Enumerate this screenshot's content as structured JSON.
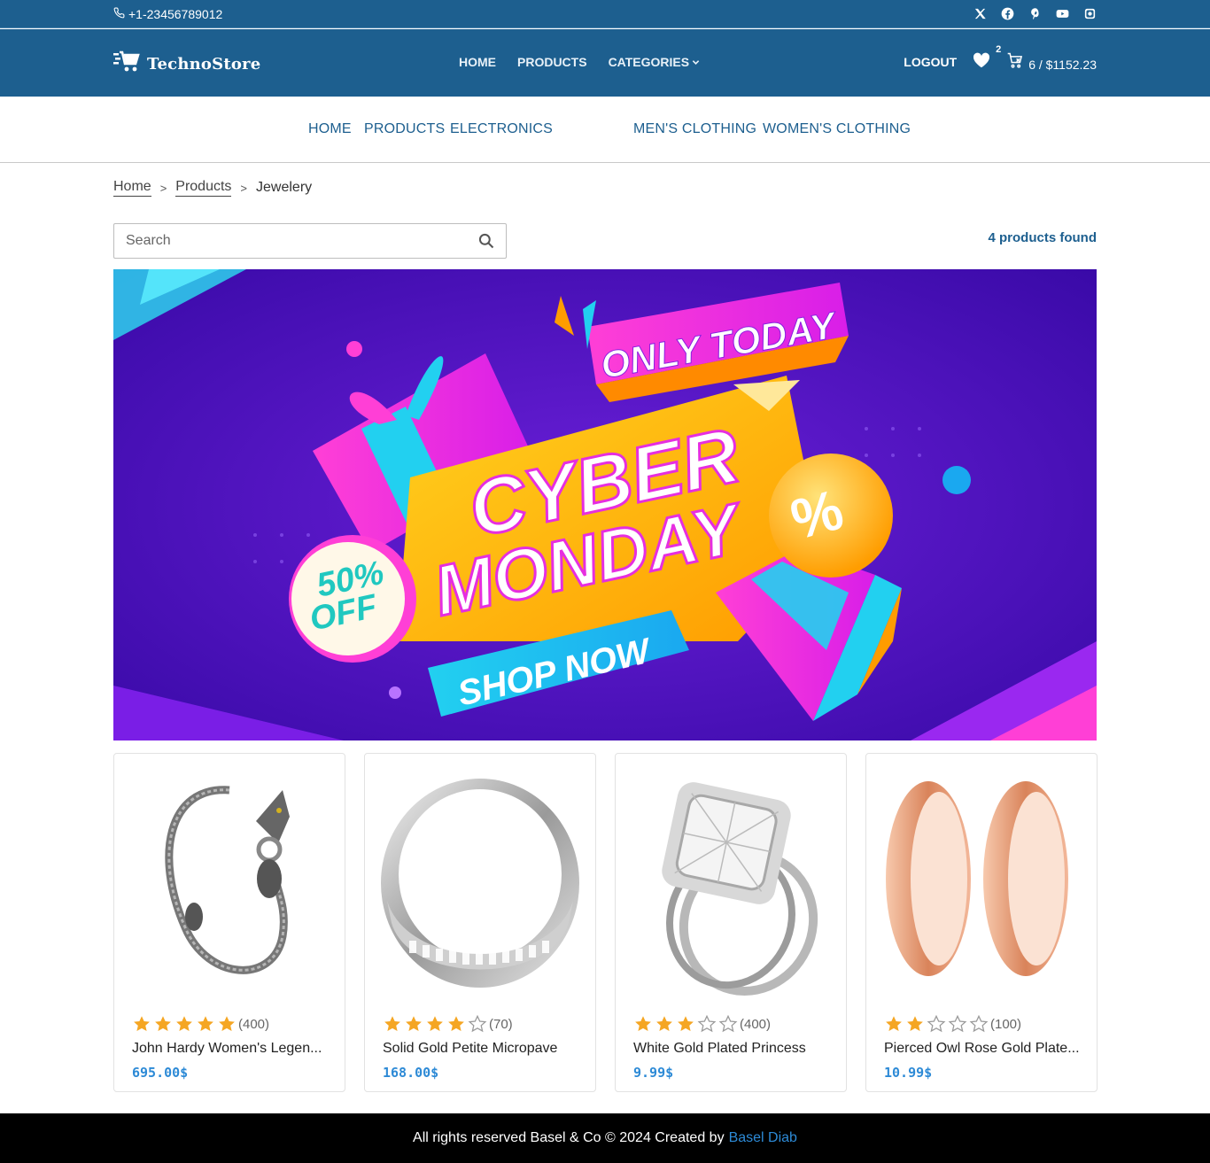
{
  "topbar": {
    "phone": "+1-23456789012",
    "socials": [
      "x-icon",
      "facebook-icon",
      "pinterest-icon",
      "youtube-icon",
      "instagram-icon"
    ]
  },
  "header": {
    "brand": "TechnoStore",
    "nav": [
      {
        "label": "HOME"
      },
      {
        "label": "PRODUCTS"
      },
      {
        "label": "CATEGORIES"
      }
    ],
    "logout": "LOGOUT",
    "wishlist_count": "2",
    "cart_summary": "6 / $1152.23"
  },
  "category_nav": [
    "HOME",
    "PRODUCTS",
    "ELECTRONICS",
    "MEN'S CLOTHING",
    "WOMEN'S CLOTHING"
  ],
  "breadcrumb": {
    "items": [
      "Home",
      "Products"
    ],
    "separator": ">",
    "current": "Jewelery"
  },
  "search": {
    "placeholder": "Search",
    "value": ""
  },
  "results": "4 products found",
  "banner": {
    "only_today": "ONLY TODAY",
    "line1": "CYBER",
    "line2": "MONDAY",
    "discount_top": "50%",
    "discount_bottom": "OFF",
    "cta": "SHOP NOW",
    "percent": "%"
  },
  "products": [
    {
      "title": "John Hardy Women's Legen...",
      "rating": 5,
      "count": "(400)",
      "price": "695.00$"
    },
    {
      "title": "Solid Gold Petite Micropave",
      "rating": 4,
      "count": "(70)",
      "price": "168.00$"
    },
    {
      "title": "White Gold Plated Princess",
      "rating": 3,
      "count": "(400)",
      "price": "9.99$"
    },
    {
      "title": "Pierced Owl Rose Gold Plate...",
      "rating": 2,
      "count": "(100)",
      "price": "10.99$"
    }
  ],
  "footer": {
    "text": "All rights reserved Basel & Co © 2024 Created by",
    "author": "Basel Diab"
  },
  "colors": {
    "header_bg": "#1d5f8f",
    "accent": "#2d8ad6",
    "star": "#f5a623",
    "footer_bg": "#000000"
  }
}
